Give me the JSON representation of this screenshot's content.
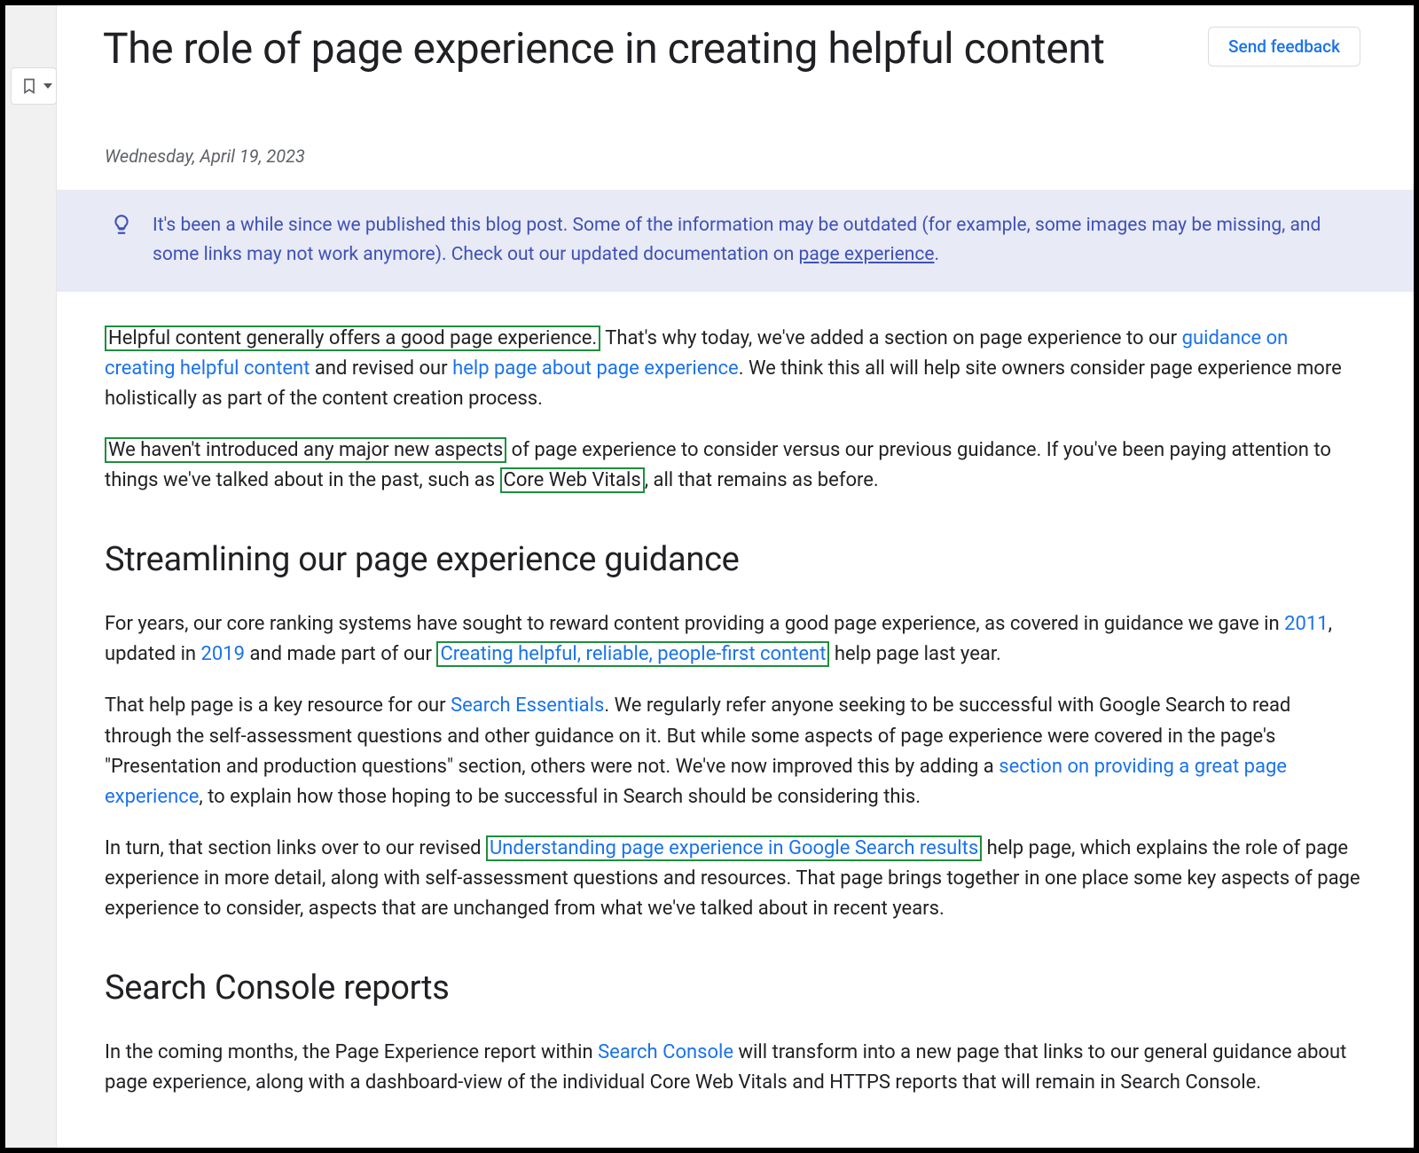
{
  "title": "The role of page experience in creating helpful content",
  "feedback_label": "Send feedback",
  "date": "Wednesday, April 19, 2023",
  "notice": {
    "pre": "It's been a while since we published this blog post. Some of the information may be outdated (for example, some images may be missing, and some links may not work anymore). Check out our updated documentation on ",
    "link": "page experience",
    "post": "."
  },
  "p1": {
    "hl1": "Helpful content generally offers a good page experience.",
    "t1": " That's why today, we've added a section on page experience to our ",
    "link1": "guidance on creating helpful content",
    "t2": " and revised our ",
    "link2": "help page about page experience",
    "t3": ". We think this all will help site owners consider page experience more holistically as part of the content creation process."
  },
  "p2": {
    "hl1": "We haven't introduced any major new aspects",
    "t1": " of page experience to consider versus our previous guidance. If you've been paying attention to things we've talked about in the past, such as ",
    "hl2": "Core Web Vitals",
    "t2": ", all that remains as before."
  },
  "h2a": "Streamlining our page experience guidance",
  "p3": {
    "t1": "For years, our core ranking systems have sought to reward content providing a good page experience, as covered in guidance we gave in ",
    "link1": "2011",
    "t2": ", updated in ",
    "link2": "2019",
    "t3": " and made part of our ",
    "hl_link": "Creating helpful, reliable, people-first content",
    "t4": " help page last year."
  },
  "p4": {
    "t1": "That help page is a key resource for our ",
    "link1": "Search Essentials",
    "t2": ". We regularly refer anyone seeking to be successful with Google Search to read through the self-assessment questions and other guidance on it. But while some aspects of page experience were covered in the page's \"Presentation and production questions\" section, others were not. We've now improved this by adding a ",
    "link2": "section on providing a great page experience",
    "t3": ", to explain how those hoping to be successful in Search should be considering this."
  },
  "p5": {
    "t1": "In turn, that section links over to our revised ",
    "hl_link": "Understanding page experience in Google Search results",
    "t2": " help page, which explains the role of page experience in more detail, along with self-assessment questions and resources. That page brings together in one place some key aspects of page experience to consider, aspects that are unchanged from what we've talked about in recent years."
  },
  "h2b": "Search Console reports",
  "p6": {
    "t1": "In the coming months, the Page Experience report within ",
    "link1": "Search Console",
    "t2": " will transform into a new page that links to our general guidance about page experience, along with a dashboard-view of the individual Core Web Vitals and HTTPS reports that will remain in Search Console."
  }
}
